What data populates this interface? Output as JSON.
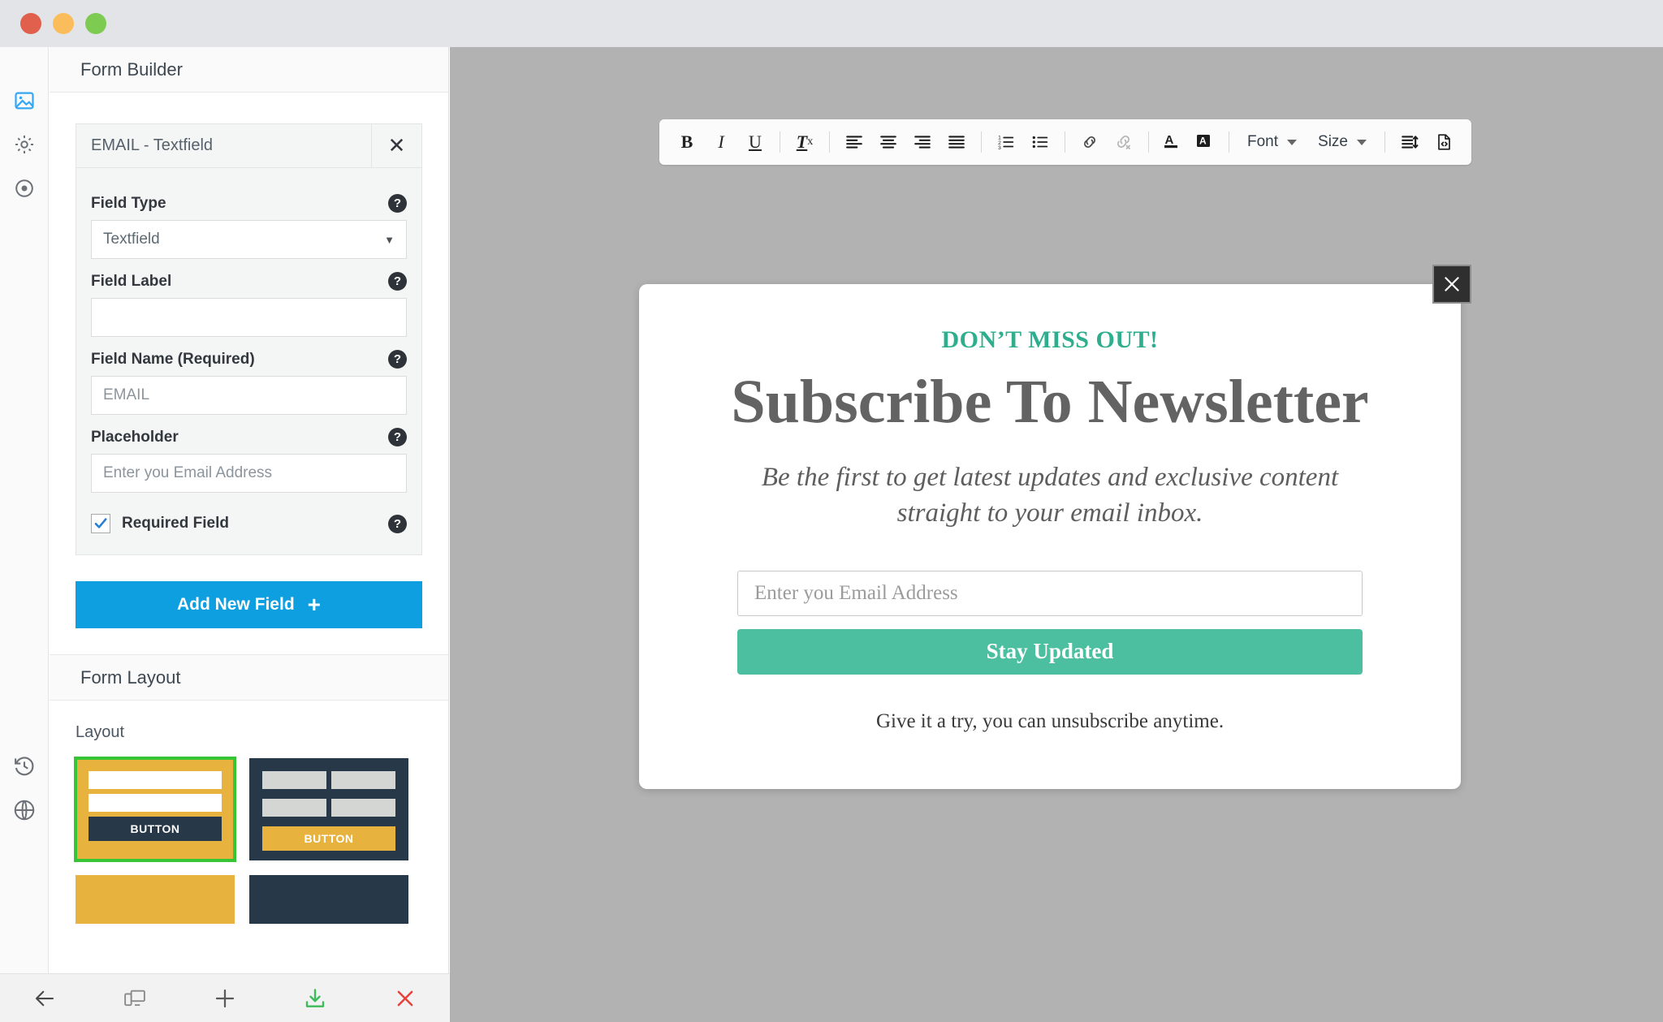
{
  "window": {
    "traffic_lights": [
      "close",
      "minimize",
      "maximize"
    ],
    "colors": {
      "close": "#e0604d",
      "minimize": "#fbbd5b",
      "maximize": "#7ecb51",
      "titlebar_bg": "#e2e4e8",
      "canvas_bg": "#b2b2b2",
      "accent_blue": "#0e9fe0",
      "accent_green": "#4cbfa1",
      "eyebrow_green": "#2fae8e",
      "layout_gold": "#e8b23e",
      "layout_dark": "#273849",
      "selected_outline": "#35c535"
    }
  },
  "icon_rail": {
    "items": [
      {
        "name": "image-icon",
        "active": true
      },
      {
        "name": "gear-icon",
        "active": false
      },
      {
        "name": "target-icon",
        "active": false
      }
    ],
    "bottom_items": [
      {
        "name": "history-icon"
      },
      {
        "name": "globe-icon"
      }
    ]
  },
  "sidebar": {
    "header": "Form Builder",
    "field_card": {
      "title": "EMAIL - Textfield",
      "close_label": "✕",
      "properties": [
        {
          "label": "Field Type",
          "type": "select",
          "value": "Textfield",
          "placeholder": ""
        },
        {
          "label": "Field Label",
          "type": "text",
          "value": "",
          "placeholder": ""
        },
        {
          "label": "Field Name (Required)",
          "type": "text",
          "value": "",
          "placeholder": "EMAIL"
        },
        {
          "label": "Placeholder",
          "type": "text",
          "value": "",
          "placeholder": "Enter you Email Address"
        }
      ],
      "checkbox": {
        "label": "Required Field",
        "checked": true
      },
      "help_glyph": "?"
    },
    "add_new_field": {
      "label": "Add New Field",
      "icon": "plus-icon"
    }
  },
  "form_layout": {
    "header": "Form Layout",
    "layout_title": "Layout",
    "thumbnails": [
      {
        "id": "layout-1",
        "style": "gold",
        "selected": true,
        "rows": 2,
        "columns": 1,
        "button_label": "BUTTON",
        "button_style": "dark"
      },
      {
        "id": "layout-2",
        "style": "dark",
        "selected": false,
        "rows": 2,
        "columns": 2,
        "button_label": "BUTTON",
        "button_style": "gold"
      },
      {
        "id": "layout-3",
        "style": "gold",
        "selected": false,
        "rows": 0,
        "columns": 0,
        "button_label": "",
        "button_style": ""
      },
      {
        "id": "layout-4",
        "style": "dark",
        "selected": false,
        "rows": 0,
        "columns": 0,
        "button_label": "",
        "button_style": ""
      }
    ]
  },
  "bottom_bar": {
    "items": [
      {
        "name": "back-arrow-icon",
        "color": "#4a4a4a"
      },
      {
        "name": "responsive-devices-icon",
        "color": "#7a7a7a"
      },
      {
        "name": "add-plus-icon",
        "color": "#5a5a5a"
      },
      {
        "name": "download-save-icon",
        "color": "#3cbb5a"
      },
      {
        "name": "close-delete-icon",
        "color": "#e8403a"
      }
    ]
  },
  "editor_toolbar": {
    "groups": [
      {
        "buttons": [
          {
            "name": "bold-icon",
            "label": "B"
          },
          {
            "name": "italic-icon",
            "label": "I"
          },
          {
            "name": "underline-icon",
            "label": "U"
          }
        ]
      },
      {
        "buttons": [
          {
            "name": "remove-format-icon",
            "label": "Tx"
          }
        ]
      },
      {
        "buttons": [
          {
            "name": "align-left-icon",
            "label": ""
          },
          {
            "name": "align-center-icon",
            "label": ""
          },
          {
            "name": "align-right-icon",
            "label": ""
          },
          {
            "name": "align-justify-icon",
            "label": ""
          }
        ]
      },
      {
        "buttons": [
          {
            "name": "numbered-list-icon",
            "label": ""
          },
          {
            "name": "bulleted-list-icon",
            "label": ""
          }
        ]
      },
      {
        "buttons": [
          {
            "name": "insert-link-icon",
            "label": ""
          },
          {
            "name": "unlink-icon",
            "label": ""
          }
        ]
      },
      {
        "buttons": [
          {
            "name": "text-color-icon",
            "label": "A"
          },
          {
            "name": "background-color-icon",
            "label": "A"
          }
        ]
      },
      {
        "dropdowns": [
          {
            "name": "font-dropdown",
            "label": "Font"
          },
          {
            "name": "size-dropdown",
            "label": "Size"
          }
        ]
      },
      {
        "buttons": [
          {
            "name": "line-height-icon",
            "label": ""
          },
          {
            "name": "source-code-icon",
            "label": ""
          }
        ]
      }
    ],
    "font_label": "Font",
    "size_label": "Size"
  },
  "newsletter_modal": {
    "close_label": "✕",
    "eyebrow": "DON’T MISS OUT!",
    "heading": "Subscribe To Newsletter",
    "subheading": "Be the first to get latest updates and exclusive content straight to your email inbox.",
    "email_placeholder": "Enter you Email Address",
    "email_value": "",
    "submit_label": "Stay Updated",
    "footnote": "Give it a try, you can unsubscribe anytime."
  }
}
